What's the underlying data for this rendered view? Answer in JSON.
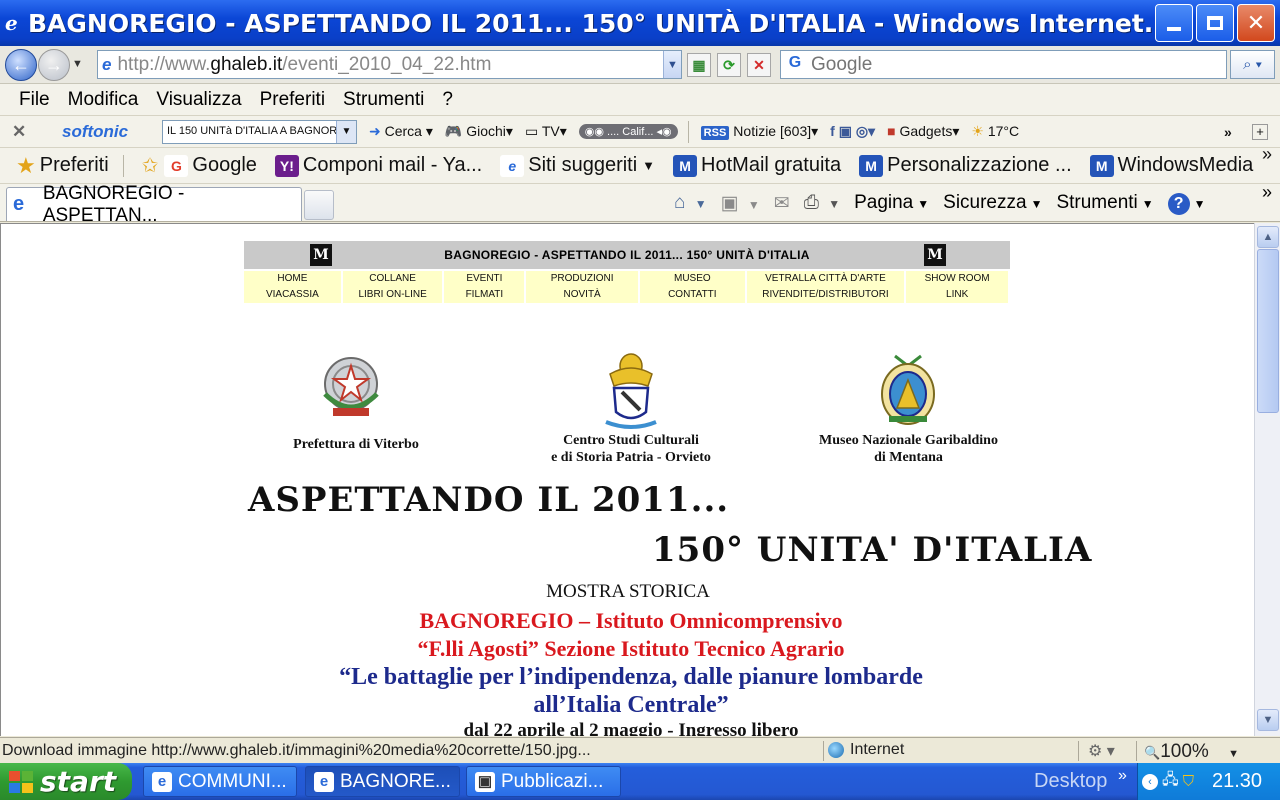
{
  "window": {
    "title": "BAGNOREGIO - ASPETTANDO IL 2011... 150° UNITÀ D'ITALIA - Windows Internet..."
  },
  "address": {
    "url_prefix": "http://www.",
    "url_domain": "ghaleb.it",
    "url_path": "/eventi_2010_04_22.htm",
    "search_placeholder": "Google"
  },
  "menu": [
    "File",
    "Modifica",
    "Visualizza",
    "Preferiti",
    "Strumenti",
    "?"
  ],
  "toolbar": {
    "brand": "softonic",
    "combo_value": "IL 150 UNITà D'ITALIA A BAGNOR",
    "cerca": "Cerca",
    "giochi": "Giochi",
    "tv": "TV",
    "radio": ".... Calif...",
    "rss": "RSS",
    "notizie": "Notizie [603]",
    "gadgets": "Gadgets",
    "weather": "17°C"
  },
  "favorites": {
    "label": "Preferiti",
    "items": [
      "Google",
      "Componi mail - Ya...",
      "Siti suggeriti",
      "HotMail gratuita",
      "Personalizzazione ...",
      "WindowsMedia"
    ]
  },
  "tab": {
    "title": "BAGNOREGIO - ASPETTAN..."
  },
  "commands": {
    "pagina": "Pagina",
    "sicurezza": "Sicurezza",
    "strumenti": "Strumenti"
  },
  "page": {
    "header_title": "BAGNOREGIO - ASPETTANDO IL 2011... 150° UNITÀ D'ITALIA",
    "logo_letter": "M",
    "nav_row1": [
      "HOME",
      "COLLANE",
      "EVENTI",
      "PRODUZIONI",
      "MUSEO",
      "VETRALLA CITTÀ D'ARTE",
      "SHOW ROOM"
    ],
    "nav_row2": [
      "VIACASSIA",
      "LIBRI ON-LINE",
      "FILMATI",
      "NOVITÀ",
      "CONTATTI",
      "RIVENDITE/DISTRIBUTORI",
      "LINK"
    ],
    "crest1_label": "Prefettura di Viterbo",
    "crest2_label_line1": "Centro Studi Culturali",
    "crest2_label_line2": "e di Storia Patria - Orvieto",
    "crest3_label_line1": "Museo Nazionale Garibaldino",
    "crest3_label_line2": "di Mentana",
    "headline1": "ASPETTANDO IL 2011...",
    "headline2": "150° UNITA' D'ITALIA",
    "mostra": "MOSTRA STORICA",
    "red1": "BAGNOREGIO – Istituto Omnicomprensivo",
    "red2": "“F.lli Agosti” Sezione Istituto Tecnico Agrario",
    "blue1": "“Le battaglie per l’indipendenza, dalle pianure lombarde",
    "blue2": "all’Italia Centrale”",
    "date": "dal 22 aprile al 2 maggio - Ingresso libero"
  },
  "status": {
    "text": "Download immagine http://www.ghaleb.it/immagini%20media%20corrette/150.jpg...",
    "zone": "Internet",
    "zoom": "100%"
  },
  "taskbar": {
    "start": "start",
    "tasks": [
      "COMMUNI...",
      "BAGNORE...",
      "Pubblicazi..."
    ],
    "desktop": "Desktop",
    "clock": "21.30"
  }
}
